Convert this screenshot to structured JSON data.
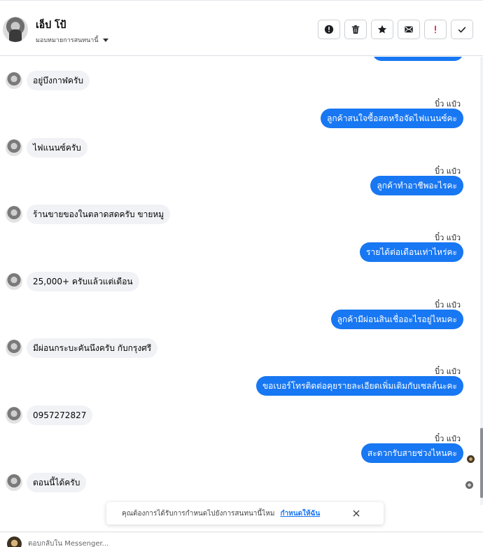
{
  "header": {
    "contact_name": "เอ็ป โป้",
    "assign_label": "มอบหมายการสนทนานี้",
    "actions": [
      {
        "name": "mark-spam-button",
        "icon": "alert-circle-icon"
      },
      {
        "name": "delete-button",
        "icon": "trash-icon"
      },
      {
        "name": "star-button",
        "icon": "star-icon"
      },
      {
        "name": "mark-unread-button",
        "icon": "mail-open-icon"
      },
      {
        "name": "follow-up-button",
        "icon": "exclamation-icon"
      },
      {
        "name": "mark-done-button",
        "icon": "check-icon"
      }
    ]
  },
  "messages": [
    {
      "dir": "out",
      "text": ""
    },
    {
      "dir": "in",
      "text": "อยู่บึงกาฬครับ"
    },
    {
      "dir": "out",
      "sender": "บิ๋ว แป๋ว",
      "text": "ลูกค้าสนใจซื้อสดหรือจัดไฟแนนซ์คะ"
    },
    {
      "dir": "in",
      "text": "ไฟแนนซ์ครับ"
    },
    {
      "dir": "out",
      "sender": "บิ๋ว แป๋ว",
      "text": "ลูกค้าทำอาชีพอะไรคะ"
    },
    {
      "dir": "in",
      "text": "ร้านขายของในตลาดสดครับ ขายหมู"
    },
    {
      "dir": "out",
      "sender": "บิ๋ว แป๋ว",
      "text": "รายได้ต่อเดือนเท่าไหร่คะ"
    },
    {
      "dir": "in",
      "text": "25,000+ ครับแล้วแต่เดือน"
    },
    {
      "dir": "out",
      "sender": "บิ๋ว แป๋ว",
      "text": "ลูกค้ามีผ่อนสินเชื่ออะไรอยู่ไหมคะ"
    },
    {
      "dir": "in",
      "text": "มีผ่อนกระบะคันนึงครับ กับกรุงศรี"
    },
    {
      "dir": "out",
      "sender": "บิ๋ว แป๋ว",
      "text": "ขอเบอร์โทรติดต่อคุยรายละเอียดเพิ่มเติมกับเซลล์นะคะ"
    },
    {
      "dir": "in",
      "text": "0957272827"
    },
    {
      "dir": "out",
      "sender": "บิ๋ว แป๋ว",
      "text": "สะดวกรับสายช่วงไหนคะ"
    },
    {
      "dir": "in",
      "text": "ตอนนี้ได้ครับ"
    }
  ],
  "notice": {
    "text": "คุณต้องการได้รับการกำหนดไปยังการสนทนานี้ไหม",
    "link": "กำหนดให้ฉัน"
  },
  "composer": {
    "placeholder": "ตอบกลับใน Messenger..."
  },
  "colors": {
    "outgoing_bubble": "#1877f2",
    "incoming_bubble": "#f0f2f5",
    "follow_up_icon": "#e41e3f"
  }
}
